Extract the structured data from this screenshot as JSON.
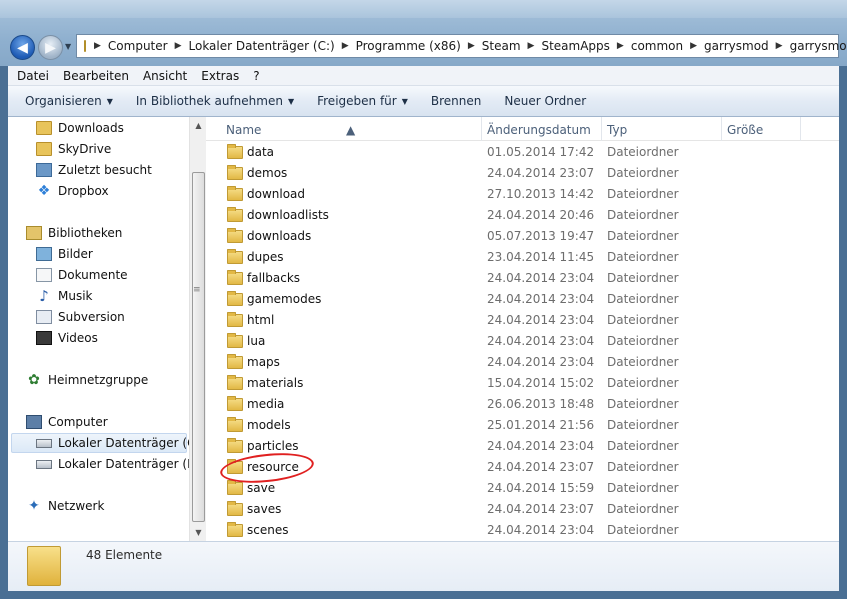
{
  "address": {
    "crumbs": [
      "Computer",
      "Lokaler Datenträger (C:)",
      "Programme (x86)",
      "Steam",
      "SteamApps",
      "common",
      "garrysmod",
      "garrysmod"
    ]
  },
  "menubar": [
    "Datei",
    "Bearbeiten",
    "Ansicht",
    "Extras",
    "?"
  ],
  "commands": {
    "organize": "Organisieren",
    "library": "In Bibliothek aufnehmen",
    "share": "Freigeben für",
    "burn": "Brennen",
    "new_folder": "Neuer Ordner"
  },
  "nav": {
    "favorites": [
      "Downloads",
      "SkyDrive",
      "Zuletzt besucht",
      "Dropbox"
    ],
    "libraries_label": "Bibliotheken",
    "libraries": [
      "Bilder",
      "Dokumente",
      "Musik",
      "Subversion",
      "Videos"
    ],
    "homegroup": "Heimnetzgruppe",
    "computer": "Computer",
    "drives": [
      "Lokaler Datenträger (C:)",
      "Lokaler Datenträger (D:)"
    ],
    "network": "Netzwerk"
  },
  "columns": {
    "name": "Name",
    "date": "Änderungsdatum",
    "type": "Typ",
    "size": "Größe"
  },
  "files": [
    {
      "name": "data",
      "date": "01.05.2014 17:42",
      "type": "Dateiordner"
    },
    {
      "name": "demos",
      "date": "24.04.2014 23:07",
      "type": "Dateiordner"
    },
    {
      "name": "download",
      "date": "27.10.2013 14:42",
      "type": "Dateiordner"
    },
    {
      "name": "downloadlists",
      "date": "24.04.2014 20:46",
      "type": "Dateiordner"
    },
    {
      "name": "downloads",
      "date": "05.07.2013 19:47",
      "type": "Dateiordner"
    },
    {
      "name": "dupes",
      "date": "23.04.2014 11:45",
      "type": "Dateiordner"
    },
    {
      "name": "fallbacks",
      "date": "24.04.2014 23:04",
      "type": "Dateiordner"
    },
    {
      "name": "gamemodes",
      "date": "24.04.2014 23:04",
      "type": "Dateiordner"
    },
    {
      "name": "html",
      "date": "24.04.2014 23:04",
      "type": "Dateiordner"
    },
    {
      "name": "lua",
      "date": "24.04.2014 23:04",
      "type": "Dateiordner"
    },
    {
      "name": "maps",
      "date": "24.04.2014 23:04",
      "type": "Dateiordner"
    },
    {
      "name": "materials",
      "date": "15.04.2014 15:02",
      "type": "Dateiordner"
    },
    {
      "name": "media",
      "date": "26.06.2013 18:48",
      "type": "Dateiordner"
    },
    {
      "name": "models",
      "date": "25.01.2014 21:56",
      "type": "Dateiordner"
    },
    {
      "name": "particles",
      "date": "24.04.2014 23:04",
      "type": "Dateiordner"
    },
    {
      "name": "resource",
      "date": "24.04.2014 23:07",
      "type": "Dateiordner"
    },
    {
      "name": "save",
      "date": "24.04.2014 15:59",
      "type": "Dateiordner"
    },
    {
      "name": "saves",
      "date": "24.04.2014 23:07",
      "type": "Dateiordner"
    },
    {
      "name": "scenes",
      "date": "24.04.2014 23:04",
      "type": "Dateiordner"
    }
  ],
  "status": {
    "count": "48 Elemente"
  }
}
